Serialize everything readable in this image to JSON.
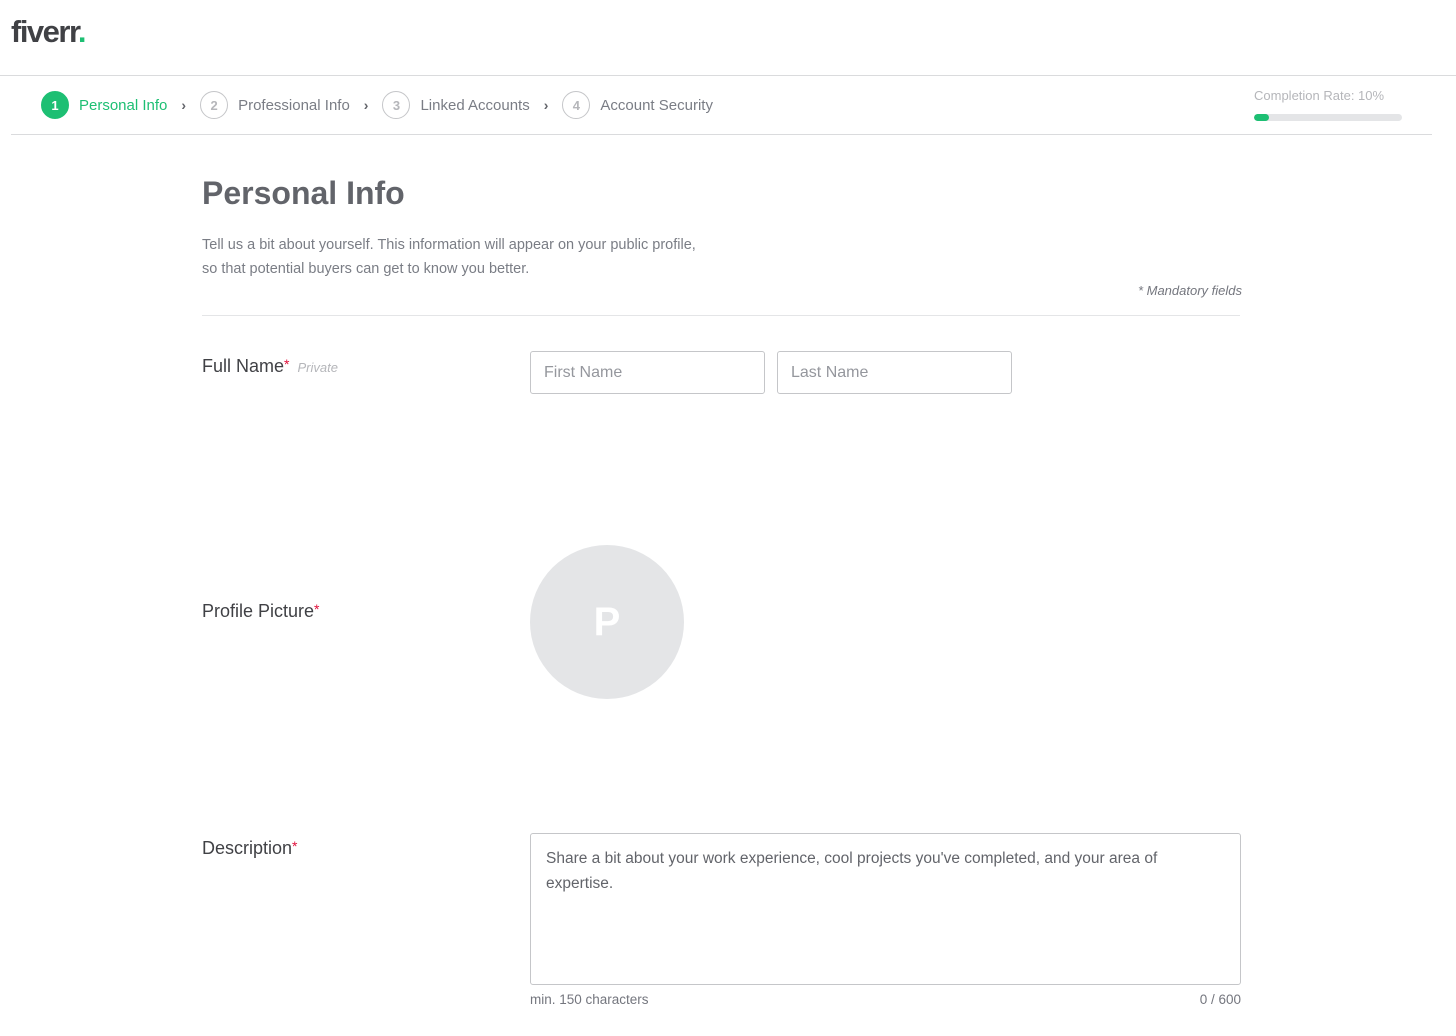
{
  "brand": {
    "logo_text": "fiverr",
    "logo_dot": ".",
    "accent_color": "#1dbf73"
  },
  "steps": [
    {
      "number": "1",
      "label": "Personal Info",
      "active": true
    },
    {
      "number": "2",
      "label": "Professional Info",
      "active": false
    },
    {
      "number": "3",
      "label": "Linked Accounts",
      "active": false
    },
    {
      "number": "4",
      "label": "Account Security",
      "active": false
    }
  ],
  "step_separator_icon": "chevron-right-icon",
  "completion": {
    "label": "Completion Rate: 10%",
    "percent": 10
  },
  "page": {
    "title": "Personal Info",
    "subtitle": "Tell us a bit about yourself. This information will appear on your public profile, so that potential buyers can get to know you better.",
    "mandatory_note": "* Mandatory fields"
  },
  "fields": {
    "full_name": {
      "label": "Full Name",
      "required_mark": "*",
      "private_tag": "Private",
      "first_name": {
        "value": "",
        "placeholder": "First Name"
      },
      "last_name": {
        "value": "",
        "placeholder": "Last Name"
      }
    },
    "profile_picture": {
      "label": "Profile Picture",
      "required_mark": "*",
      "avatar_initial": "P"
    },
    "description": {
      "label": "Description",
      "required_mark": "*",
      "value": "",
      "placeholder": "Share a bit about your work experience, cool projects you've completed, and your area of expertise.",
      "min_hint": "min. 150 characters",
      "counter": "0 / 600"
    }
  }
}
